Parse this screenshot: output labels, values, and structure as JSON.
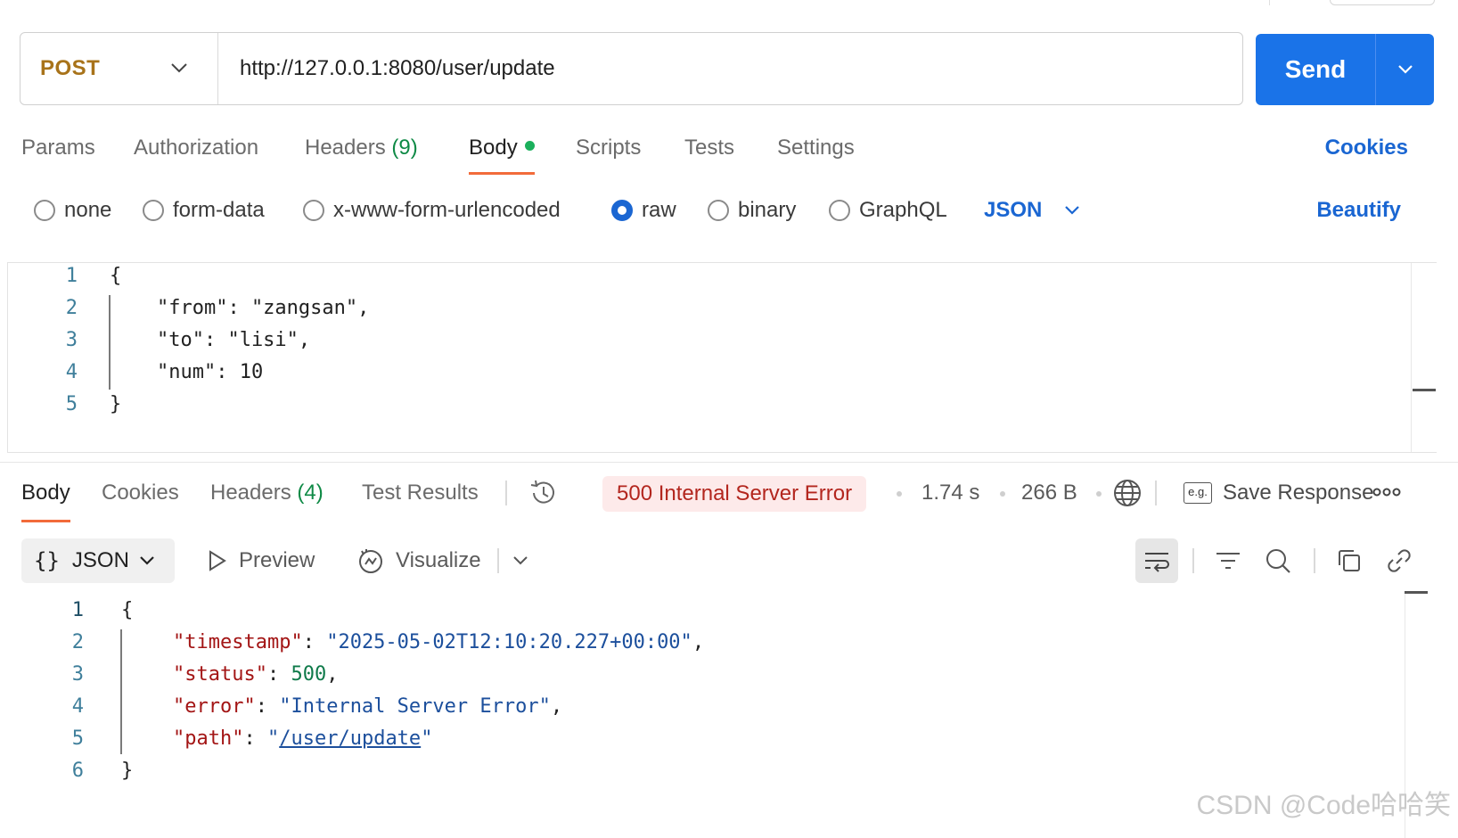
{
  "request": {
    "method": "POST",
    "url": "http://127.0.0.1:8080/user/update",
    "send_label": "Send"
  },
  "request_tabs": {
    "params": "Params",
    "authorization": "Authorization",
    "headers": "Headers",
    "headers_count": "(9)",
    "body": "Body",
    "scripts": "Scripts",
    "tests": "Tests",
    "settings": "Settings",
    "cookies": "Cookies"
  },
  "body_types": {
    "none": "none",
    "form_data": "form-data",
    "urlencoded": "x-www-form-urlencoded",
    "raw": "raw",
    "binary": "binary",
    "graphql": "GraphQL",
    "selected": "raw",
    "format": "JSON",
    "beautify": "Beautify"
  },
  "request_body": {
    "line_numbers": [
      "1",
      "2",
      "3",
      "4",
      "5"
    ],
    "lines": [
      "{",
      "    \"from\": \"zangsan\",",
      "    \"to\": \"lisi\",",
      "    \"num\": 10",
      "}"
    ]
  },
  "response_tabs": {
    "body": "Body",
    "cookies": "Cookies",
    "headers": "Headers",
    "headers_count": "(4)",
    "test_results": "Test Results"
  },
  "response_meta": {
    "status": "500 Internal Server Error",
    "time": "1.74 s",
    "size": "266 B",
    "save_response": "Save Response",
    "eg_label": "e.g."
  },
  "response_toolbar": {
    "format": "JSON",
    "braces": "{}",
    "preview": "Preview",
    "visualize": "Visualize"
  },
  "response_body": {
    "line_numbers": [
      "1",
      "2",
      "3",
      "4",
      "5",
      "6"
    ],
    "open": "{",
    "close": "}",
    "timestamp_key": "\"timestamp\"",
    "timestamp_val": "\"2025-05-02T12:10:20.227+00:00\"",
    "status_key": "\"status\"",
    "status_val": "500",
    "error_key": "\"error\"",
    "error_val": "\"Internal Server Error\"",
    "path_key": "\"path\"",
    "path_val": "/user/update"
  },
  "watermark": "CSDN @Code哈哈笑",
  "colors": {
    "method": "#a8731a",
    "send_bg": "#1a73e8",
    "accent_link": "#1a66d2",
    "tab_underline": "#f26b3a",
    "count_green": "#0f8a46",
    "error_badge_bg": "#fdeaea",
    "error_badge_text": "#b3261e",
    "json_key": "#a31515",
    "json_string": "#1c4f9c",
    "json_number": "#0f7a4a"
  }
}
